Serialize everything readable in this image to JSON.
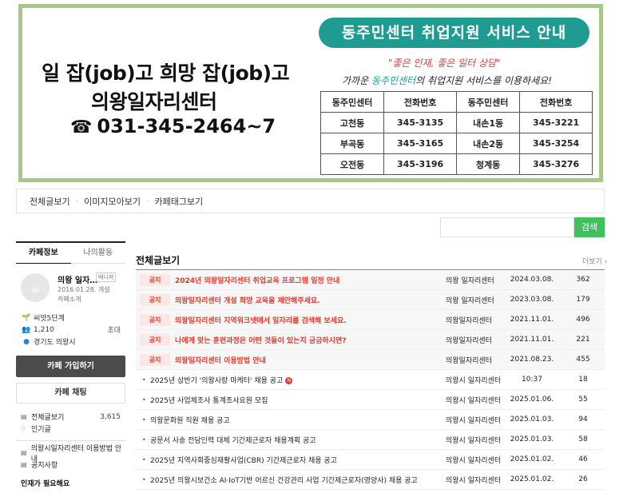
{
  "banner": {
    "slogan_line1": "일 잡(job)고 희망 잡(job)고",
    "slogan_line2": "의왕일자리센터",
    "phone": "031-345-2464~7",
    "headline": "동주민센터 취업지원 서비스 안내",
    "quote": "\"좋은 인재, 좋은 일터 상담\"",
    "invite_pre": "가까운 ",
    "invite_hl": "동주민센터",
    "invite_post": "의 취업지원 서비스를 이용하세요!",
    "table_headers": [
      "동주민센터",
      "전화번호",
      "동주민센터",
      "전화번호"
    ],
    "table_rows": [
      [
        "고천동",
        "345-3135",
        "내손1동",
        "345-3221"
      ],
      [
        "부곡동",
        "345-3165",
        "내손2동",
        "345-3254"
      ],
      [
        "오전동",
        "345-3196",
        "청계동",
        "345-3276"
      ]
    ]
  },
  "tabs": [
    "전체글보기",
    "이미지모아보기",
    "카페태그보기"
  ],
  "search": {
    "placeholder": "",
    "button": "검색"
  },
  "sidebar": {
    "tabs": [
      "카페정보",
      "나의활동"
    ],
    "cafe_name": "의왕 일자…",
    "manager_badge": "매니저",
    "created": "2016.01.28. 개설",
    "intro_link": "카페소개",
    "level": "씨앗5단계",
    "members": "1,210",
    "invite": "초대",
    "location": "경기도 의왕시",
    "join_button": "카페 가입하기",
    "chat_button": "카페 채팅",
    "menu": [
      {
        "label": "전체글보기",
        "count": "3,615"
      },
      {
        "label": "인기글",
        "count": ""
      }
    ],
    "menu2": [
      "의왕시일자리센터 이용방법 안내",
      "공지사항"
    ],
    "section_heading": "인재가 필요해요"
  },
  "board": {
    "title": "전체글보기",
    "more": "더보기",
    "notice_label": "공지",
    "notices": [
      {
        "title": "2024년 의왕일자리센터 취업교육 프로그램 일정 안내",
        "author": "의왕 일자리센터",
        "date": "2024.03.08.",
        "views": "362"
      },
      {
        "title": "의왕일자리센터 개설 희망 교육을 제안해주세요.",
        "author": "의왕 일자리센터",
        "date": "2023.03.08.",
        "views": "179"
      },
      {
        "title": "의왕일자리센터 지역워크넷에서 일자리를 검색해 보세요.",
        "author": "의왕일자리센터",
        "date": "2021.11.01.",
        "views": "496"
      },
      {
        "title": "나에게 맞는 훈련과정은 어떤 것들이 있는지 궁금하시면?",
        "author": "의왕일자리센터",
        "date": "2021.11.01.",
        "views": "221"
      },
      {
        "title": "의왕일자리센터 이용방법 안내",
        "author": "의왕일자리센터",
        "date": "2021.08.23.",
        "views": "455"
      }
    ],
    "posts": [
      {
        "title": "2025년 상반기 '의왕사랑 마케터' 채용 공고",
        "new": true,
        "author": "의왕시 일자리센터",
        "date": "10:37",
        "views": "18"
      },
      {
        "title": "2025년 사업체조사 통계조사요원 모집",
        "new": false,
        "author": "의왕시 일자리센터",
        "date": "2025.01.06.",
        "views": "55"
      },
      {
        "title": "의왕문화원 직원 채용 공고",
        "new": false,
        "author": "의왕시 일자리센터",
        "date": "2025.01.03.",
        "views": "94"
      },
      {
        "title": "공문서 사송 전담인력 대체 기간제근로자 채용계획 공고",
        "new": false,
        "author": "의왕시 일자리센터",
        "date": "2025.01.03.",
        "views": "58"
      },
      {
        "title": "2025년 지역사회중심재활사업(CBR) 기간제근로자 채용 공고",
        "new": false,
        "author": "의왕시 일자리센터",
        "date": "2025.01.02.",
        "views": "46"
      },
      {
        "title": "2025년 의왕시보건소 AI·IoT기반 어르신 건강관리 사업 기간제근로자(영양사) 채용 공고",
        "new": false,
        "author": "의왕시 일자리센터",
        "date": "2025.01.02.",
        "views": "26"
      }
    ]
  }
}
